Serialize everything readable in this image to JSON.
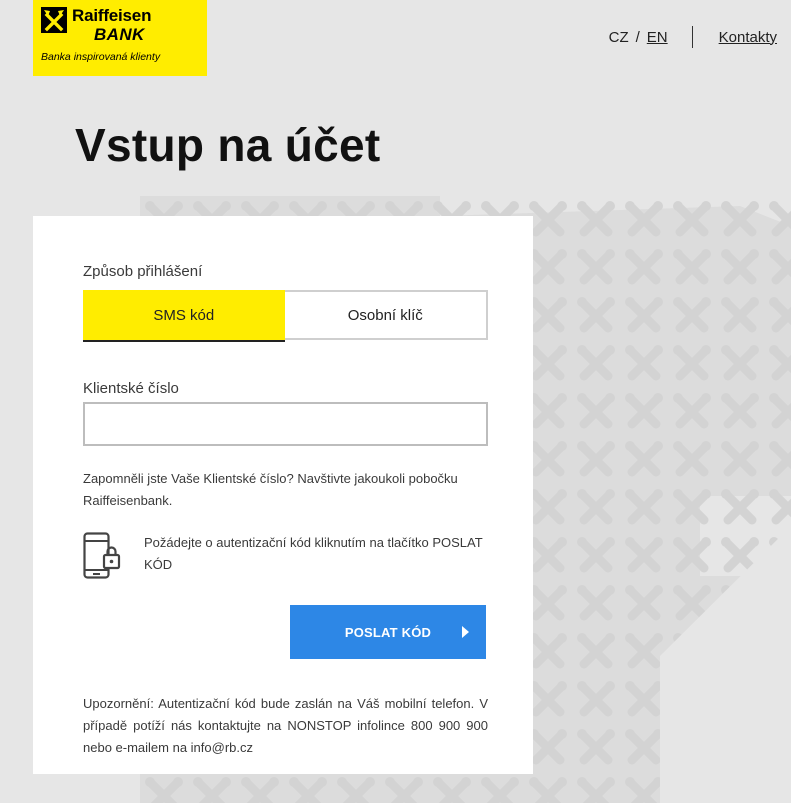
{
  "header": {
    "logo": {
      "brand_line1": "Raiffeisen",
      "brand_line2": "BANK",
      "tagline": "Banka inspirovaná klienty"
    },
    "lang_cz": "CZ",
    "lang_separator": "/",
    "lang_en": "EN",
    "contacts": "Kontakty"
  },
  "page_title": "Vstup na účet",
  "login": {
    "method_label": "Způsob přihlášení",
    "methods": [
      {
        "label": "SMS kód",
        "active": true
      },
      {
        "label": "Osobní klíč",
        "active": false
      }
    ],
    "client_number_label": "Klientské číslo",
    "client_number_value": "",
    "client_number_placeholder": "",
    "forgot_hint": "Zapomněli jste Vaše Klientské číslo? Navštivte jakoukoli pobočku Raiffeisenbank.",
    "sms_instruction": "Požádejte o autentizační kód kliknutím na tlačítko POSLAT KÓD",
    "send_button": "POSLAT KÓD",
    "notice": "Upozornění: Autentizační kód bude zaslán na Váš mobilní telefon. V případě potíží nás kontaktujte na NONSTOP infolince 800 900 900 nebo e-mailem na info@rb.cz"
  },
  "icons": {
    "logo_mark": "raiffeisen-crossed-horses-icon",
    "phone": "phone-lock-icon",
    "button_arrow": "caret-right-icon"
  },
  "colors": {
    "brand_yellow": "#ffed00",
    "button_blue": "#2d87e6",
    "background": "#e6e6e6"
  }
}
